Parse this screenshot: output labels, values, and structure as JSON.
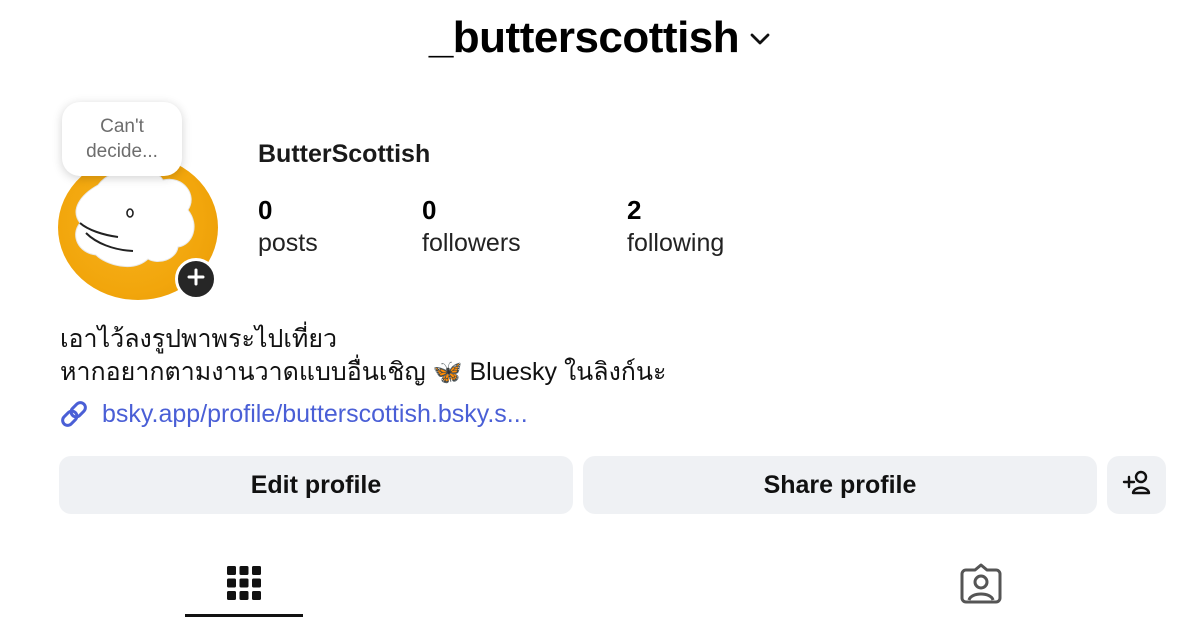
{
  "header": {
    "username": "_butterscottish",
    "chevron_icon": "chevron-down-icon"
  },
  "profile": {
    "note": "Can't\ndecide...",
    "display_name": "ButterScottish",
    "avatar_color": "#f2a60c",
    "add_icon": "plus-icon",
    "stats": {
      "posts": {
        "value": "0",
        "label": "posts"
      },
      "followers": {
        "value": "0",
        "label": "followers"
      },
      "following": {
        "value": "2",
        "label": "following"
      }
    },
    "bio": {
      "line1": "เอาไว้ลงรูปพาพระไปเที่ยว",
      "line2_before": "หากอยากตามงานวาดแบบอื่นเชิญ",
      "line2_emoji": "🦋",
      "line2_after": "Bluesky ในลิงก์นะ"
    },
    "link": {
      "icon": "link-icon",
      "text": "bsky.app/profile/butterscottish.bsky.s..."
    }
  },
  "actions": {
    "edit_label": "Edit profile",
    "share_label": "Share profile",
    "add_person_icon": "add-person-icon"
  },
  "tabs": [
    {
      "icon": "grid-icon",
      "active": true
    },
    {
      "icon": "tagged-icon",
      "active": false
    }
  ],
  "colors": {
    "button_bg": "#eff1f4",
    "link": "#4a5fd6",
    "accent_dark": "#262626"
  }
}
